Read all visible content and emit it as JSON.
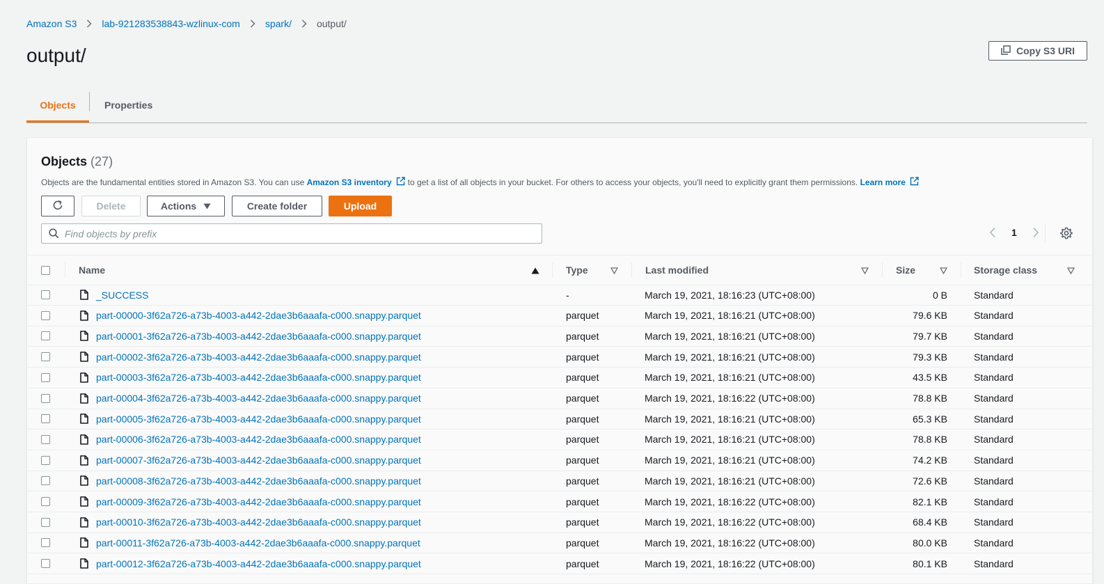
{
  "breadcrumb": [
    {
      "label": "Amazon S3"
    },
    {
      "label": "lab-921283538843-wzlinux-com"
    },
    {
      "label": "spark/"
    },
    {
      "label": "output/"
    }
  ],
  "page_title": "output/",
  "copy_uri_label": "Copy S3 URI",
  "tabs": [
    {
      "label": "Objects",
      "active": true
    },
    {
      "label": "Properties",
      "active": false
    }
  ],
  "objects_panel": {
    "title": "Objects",
    "count": "(27)",
    "description": {
      "before": "Objects are the fundamental entities stored in Amazon S3. You can use",
      "inventory_link": "Amazon S3 inventory",
      "middle": "to get a list of all objects in your bucket. For others to access your objects, you'll need to explicitly grant them permissions.",
      "learn_more": "Learn more"
    },
    "buttons": {
      "refresh_icon": "refresh-icon",
      "delete": "Delete",
      "actions": "Actions",
      "create_folder": "Create folder",
      "upload": "Upload"
    },
    "search_placeholder": "Find objects by prefix",
    "pagination": {
      "current_page": "1"
    },
    "columns": {
      "name": "Name",
      "type": "Type",
      "last_modified": "Last modified",
      "size": "Size",
      "storage_class": "Storage class"
    },
    "rows": [
      {
        "name": "_SUCCESS",
        "type": "-",
        "last_modified": "March 19, 2021, 18:16:23 (UTC+08:00)",
        "size": "0 B",
        "storage_class": "Standard"
      },
      {
        "name": "part-00000-3f62a726-a73b-4003-a442-2dae3b6aaafa-c000.snappy.parquet",
        "type": "parquet",
        "last_modified": "March 19, 2021, 18:16:21 (UTC+08:00)",
        "size": "79.6 KB",
        "storage_class": "Standard"
      },
      {
        "name": "part-00001-3f62a726-a73b-4003-a442-2dae3b6aaafa-c000.snappy.parquet",
        "type": "parquet",
        "last_modified": "March 19, 2021, 18:16:21 (UTC+08:00)",
        "size": "79.7 KB",
        "storage_class": "Standard"
      },
      {
        "name": "part-00002-3f62a726-a73b-4003-a442-2dae3b6aaafa-c000.snappy.parquet",
        "type": "parquet",
        "last_modified": "March 19, 2021, 18:16:21 (UTC+08:00)",
        "size": "79.3 KB",
        "storage_class": "Standard"
      },
      {
        "name": "part-00003-3f62a726-a73b-4003-a442-2dae3b6aaafa-c000.snappy.parquet",
        "type": "parquet",
        "last_modified": "March 19, 2021, 18:16:21 (UTC+08:00)",
        "size": "43.5 KB",
        "storage_class": "Standard"
      },
      {
        "name": "part-00004-3f62a726-a73b-4003-a442-2dae3b6aaafa-c000.snappy.parquet",
        "type": "parquet",
        "last_modified": "March 19, 2021, 18:16:22 (UTC+08:00)",
        "size": "78.8 KB",
        "storage_class": "Standard"
      },
      {
        "name": "part-00005-3f62a726-a73b-4003-a442-2dae3b6aaafa-c000.snappy.parquet",
        "type": "parquet",
        "last_modified": "March 19, 2021, 18:16:21 (UTC+08:00)",
        "size": "65.3 KB",
        "storage_class": "Standard"
      },
      {
        "name": "part-00006-3f62a726-a73b-4003-a442-2dae3b6aaafa-c000.snappy.parquet",
        "type": "parquet",
        "last_modified": "March 19, 2021, 18:16:21 (UTC+08:00)",
        "size": "78.8 KB",
        "storage_class": "Standard"
      },
      {
        "name": "part-00007-3f62a726-a73b-4003-a442-2dae3b6aaafa-c000.snappy.parquet",
        "type": "parquet",
        "last_modified": "March 19, 2021, 18:16:21 (UTC+08:00)",
        "size": "74.2 KB",
        "storage_class": "Standard"
      },
      {
        "name": "part-00008-3f62a726-a73b-4003-a442-2dae3b6aaafa-c000.snappy.parquet",
        "type": "parquet",
        "last_modified": "March 19, 2021, 18:16:21 (UTC+08:00)",
        "size": "72.6 KB",
        "storage_class": "Standard"
      },
      {
        "name": "part-00009-3f62a726-a73b-4003-a442-2dae3b6aaafa-c000.snappy.parquet",
        "type": "parquet",
        "last_modified": "March 19, 2021, 18:16:22 (UTC+08:00)",
        "size": "82.1 KB",
        "storage_class": "Standard"
      },
      {
        "name": "part-00010-3f62a726-a73b-4003-a442-2dae3b6aaafa-c000.snappy.parquet",
        "type": "parquet",
        "last_modified": "March 19, 2021, 18:16:22 (UTC+08:00)",
        "size": "68.4 KB",
        "storage_class": "Standard"
      },
      {
        "name": "part-00011-3f62a726-a73b-4003-a442-2dae3b6aaafa-c000.snappy.parquet",
        "type": "parquet",
        "last_modified": "March 19, 2021, 18:16:22 (UTC+08:00)",
        "size": "80.0 KB",
        "storage_class": "Standard"
      },
      {
        "name": "part-00012-3f62a726-a73b-4003-a442-2dae3b6aaafa-c000.snappy.parquet",
        "type": "parquet",
        "last_modified": "March 19, 2021, 18:16:22 (UTC+08:00)",
        "size": "80.1 KB",
        "storage_class": "Standard"
      }
    ]
  },
  "colors": {
    "link": "#0073bb",
    "accent": "#ec7211",
    "background": "#f2f3f3",
    "panel": "#fafafa"
  }
}
